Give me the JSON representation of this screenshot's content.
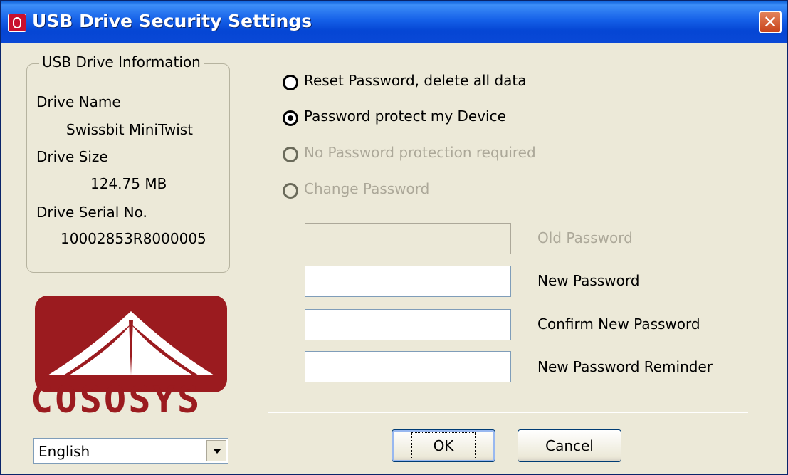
{
  "window": {
    "title": "USB Drive Security Settings",
    "close_glyph": "✕"
  },
  "drive_info": {
    "group_title": "USB Drive Information",
    "name_label": "Drive Name",
    "name_value": "Swissbit MiniTwist",
    "size_label": "Drive Size",
    "size_value": "124.75 MB",
    "serial_label": "Drive Serial No.",
    "serial_value": "10002853R8000005"
  },
  "logo": {
    "text": "COSOSYS",
    "color": "#9b1b1f"
  },
  "language": {
    "selected": "English"
  },
  "options": [
    {
      "label": "Reset Password, delete all data",
      "checked": false,
      "enabled": true
    },
    {
      "label": "Password protect my Device",
      "checked": true,
      "enabled": true
    },
    {
      "label": "No Password protection required",
      "checked": false,
      "enabled": false
    },
    {
      "label": "Change Password",
      "checked": false,
      "enabled": false
    }
  ],
  "fields": {
    "old_password": {
      "label": "Old Password",
      "value": "",
      "enabled": false
    },
    "new_password": {
      "label": "New Password",
      "value": "",
      "enabled": true
    },
    "confirm_password": {
      "label": "Confirm New Password",
      "value": "",
      "enabled": true
    },
    "reminder": {
      "label": "New Password Reminder",
      "value": "",
      "enabled": true
    }
  },
  "buttons": {
    "ok": "OK",
    "cancel": "Cancel"
  },
  "colors": {
    "titlebar": "#0a5fd8",
    "dialog_bg": "#ece9d8",
    "brand_red": "#9b1b1f",
    "close_red": "#c8431c"
  }
}
